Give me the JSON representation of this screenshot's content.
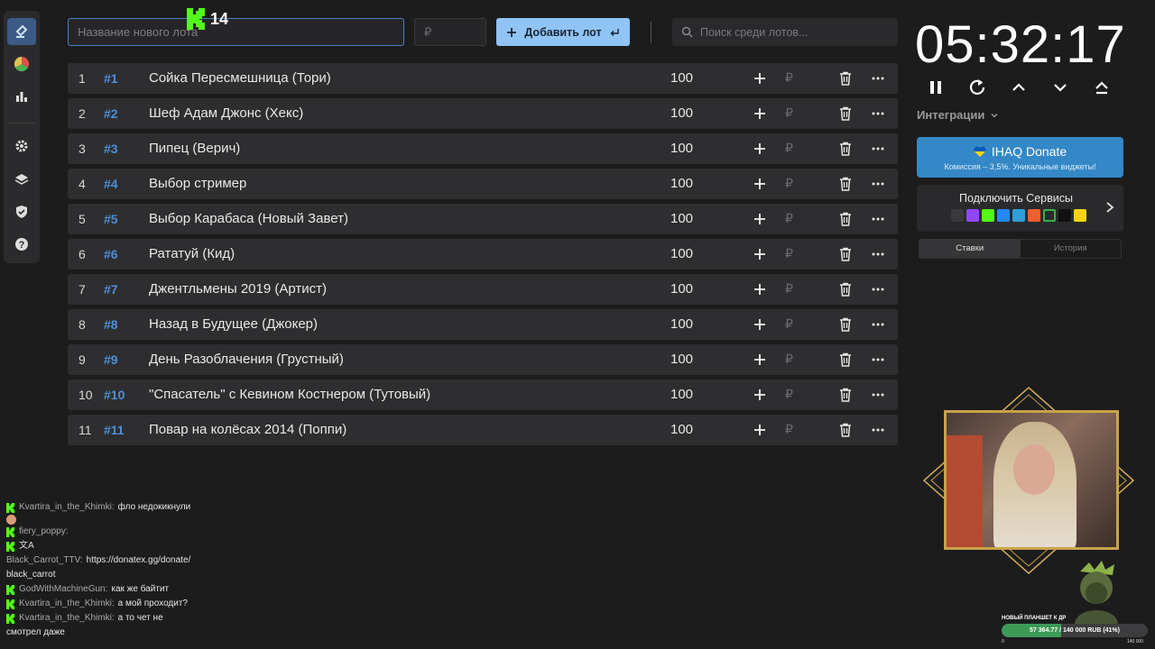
{
  "top": {
    "lot_placeholder": "Название нового лота",
    "price_placeholder": "₽",
    "add_label": "Добавить лот",
    "search_placeholder": "Поиск среди лотов...",
    "badge_count": "14"
  },
  "lots": [
    {
      "index": "1",
      "tag": "#1",
      "name": "Сойка Пересмешница (Тори)",
      "amount": "100"
    },
    {
      "index": "2",
      "tag": "#2",
      "name": "Шеф Адам Джонс (Хекс)",
      "amount": "100"
    },
    {
      "index": "3",
      "tag": "#3",
      "name": "Пипец (Верич)",
      "amount": "100"
    },
    {
      "index": "4",
      "tag": "#4",
      "name": "Выбор стример",
      "amount": "100"
    },
    {
      "index": "5",
      "tag": "#5",
      "name": "Выбор Карабаса (Новый Завет)",
      "amount": "100"
    },
    {
      "index": "6",
      "tag": "#6",
      "name": "Рататуй (Кид)",
      "amount": "100"
    },
    {
      "index": "7",
      "tag": "#7",
      "name": "Джентльмены 2019 (Артист)",
      "amount": "100"
    },
    {
      "index": "8",
      "tag": "#8",
      "name": "Назад в Будущее (Джокер)",
      "amount": "100"
    },
    {
      "index": "9",
      "tag": "#9",
      "name": "День Разоблачения (Грустный)",
      "amount": "100"
    },
    {
      "index": "10",
      "tag": "#10",
      "name": "\"Спасатель\" с Кевином Костнером (Тутовый)",
      "amount": "100"
    },
    {
      "index": "11",
      "tag": "#11",
      "name": "Повар на колёсах 2014 (Поппи)",
      "amount": "100"
    }
  ],
  "lot_currency": "₽",
  "right": {
    "timer": "05:32:17",
    "integrations": "Интеграции",
    "donate_title": "IHAQ Donate",
    "donate_sub": "Комиссия – 3,5%. Уникальные виджеты!",
    "services_title": "Подключить Сервисы",
    "tab_bids": "Ставки",
    "tab_history": "История"
  },
  "chat": [
    {
      "user": "Kvartira_in_the_Khimki:",
      "text": "фло недокикнули"
    },
    {
      "user": "fiery_poppy:",
      "text": ""
    },
    {
      "user": "Black_Carrot_TTV:",
      "text": "https://donatex.gg/donate/"
    },
    {
      "user": "",
      "text": "black_carrot"
    },
    {
      "user": "GodWithMachineGun:",
      "text": "как же байтит"
    },
    {
      "user": "Kvartira_in_the_Khimki:",
      "text": "а мой проходит?"
    },
    {
      "user": "Kvartira_in_the_Khimki:",
      "text": "а то чет не"
    },
    {
      "user": "",
      "text": "смотрел даже"
    }
  ],
  "goal": {
    "title": "НОВЫЙ ПЛАНШЕТ К ДР",
    "text": "57 364.77 / 140 000 RUB (41%)",
    "progress": 0.41,
    "min": "0",
    "max": "140 000"
  },
  "colors": {
    "accent": "#4f8fd6",
    "add_button": "#90c4f5",
    "donate": "#3488c7",
    "kick_green": "#53fc18"
  }
}
